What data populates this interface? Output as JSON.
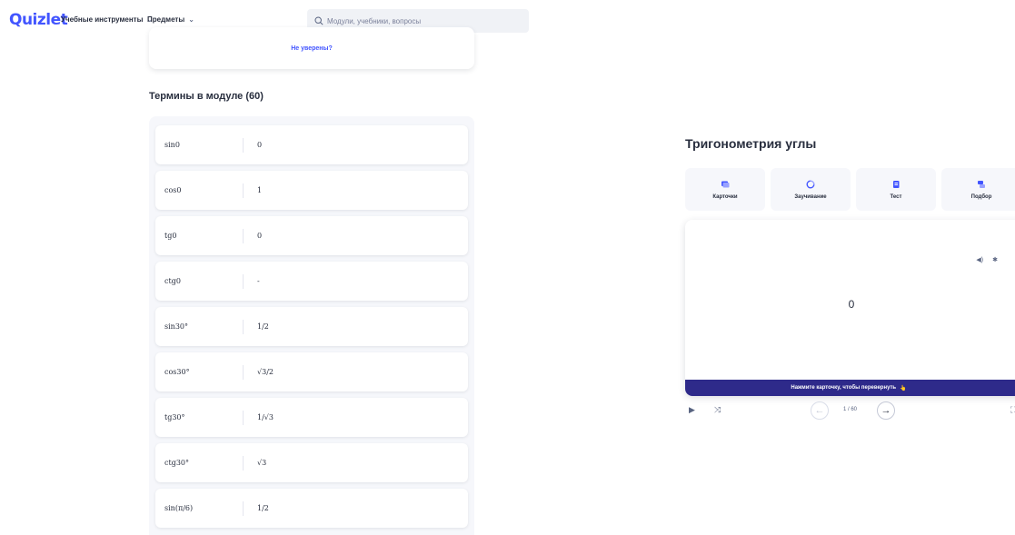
{
  "header": {
    "logo": "Quizlet",
    "nav": [
      {
        "label": "Учебные инструменты"
      },
      {
        "label": "Предметы"
      }
    ],
    "search_placeholder": "Модули, учебники, вопросы"
  },
  "not_sure": {
    "link": "Не уверены?"
  },
  "terms_section": {
    "title": "Термины в модуле (60)",
    "rows": [
      {
        "term": "sin0",
        "definition": "0"
      },
      {
        "term": "cos0",
        "definition": "1"
      },
      {
        "term": "tg0",
        "definition": "0"
      },
      {
        "term": "ctg0",
        "definition": "-"
      },
      {
        "term": "sin30°",
        "definition": "1/2"
      },
      {
        "term": "cos30°",
        "definition": "√3/2"
      },
      {
        "term": "tg30°",
        "definition": "1/√3"
      },
      {
        "term": "ctg30°",
        "definition": "√3"
      },
      {
        "term": "sin(π/6)",
        "definition": "1/2"
      }
    ]
  },
  "study": {
    "title": "Тригонометрия углы",
    "modes": [
      {
        "label": "Карточки",
        "icon": "cards-icon",
        "color": "#4255ff"
      },
      {
        "label": "Заучивание",
        "icon": "learn-icon",
        "color": "#4255ff"
      },
      {
        "label": "Тест",
        "icon": "test-icon",
        "color": "#4255ff"
      },
      {
        "label": "Подбор",
        "icon": "match-icon",
        "color": "#4255ff"
      }
    ],
    "card": {
      "term": "0",
      "banner": "Нажмите карточку, чтобы перевернуть",
      "banner_emoji": "👆"
    },
    "counter": "1 / 60"
  },
  "colors": {
    "brand": "#4255ff",
    "banner": "#2e2a8a",
    "panel_bg": "#f6f7fb"
  }
}
